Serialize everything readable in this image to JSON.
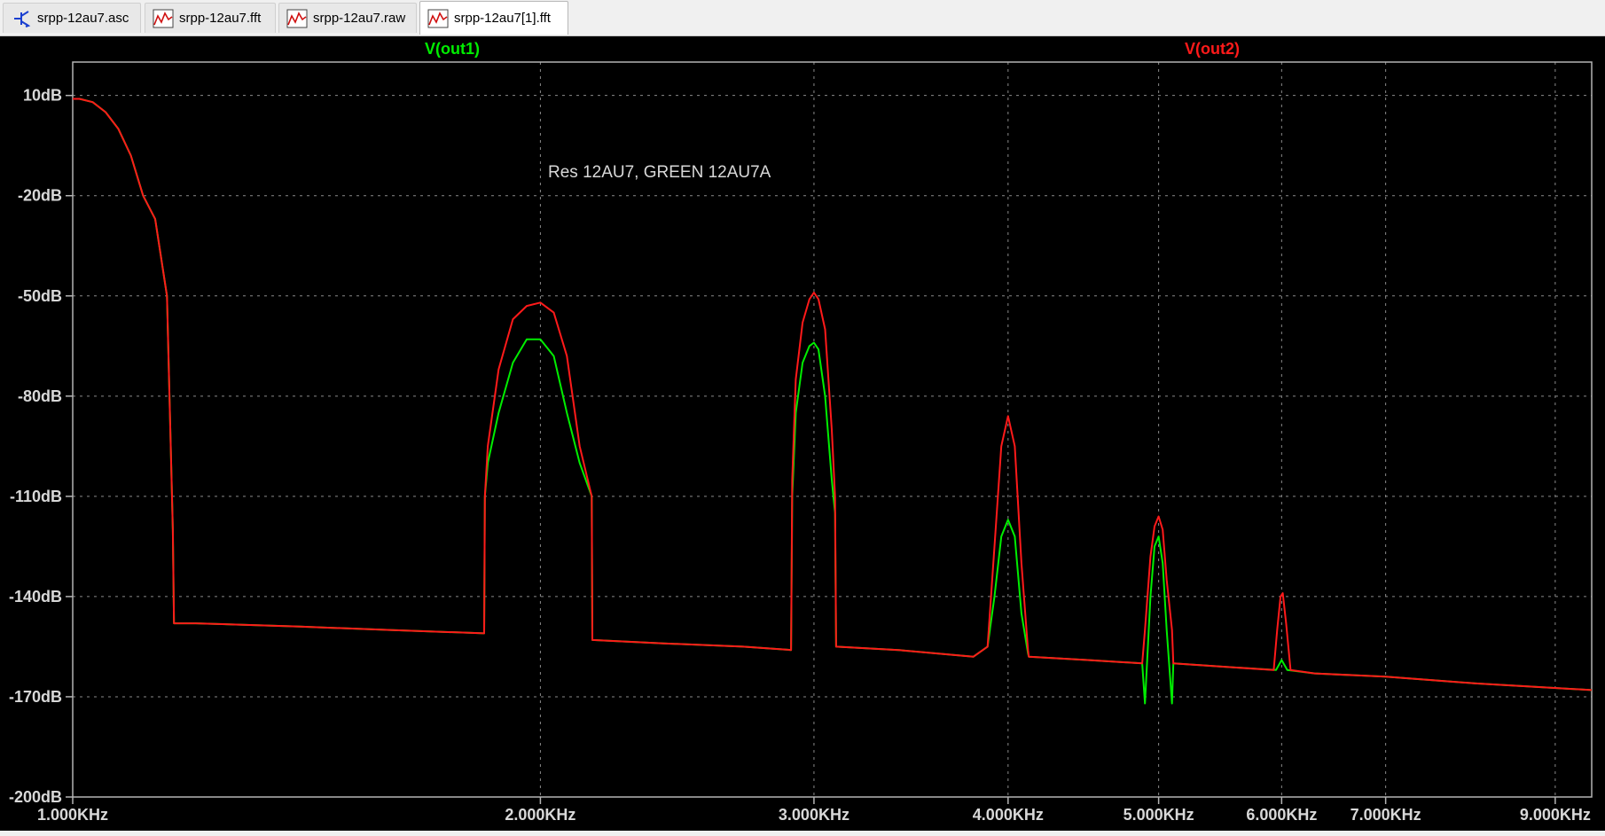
{
  "tabs": [
    {
      "label": "srpp-12au7.asc",
      "icon": "schematic-icon",
      "active": false
    },
    {
      "label": "srpp-12au7.fft",
      "icon": "waveform-icon",
      "active": false
    },
    {
      "label": "srpp-12au7.raw",
      "icon": "waveform-icon",
      "active": false
    },
    {
      "label": "srpp-12au7[1].fft",
      "icon": "waveform-icon",
      "active": true
    }
  ],
  "colors": {
    "background": "#000000",
    "grid": "#8a8a8a",
    "axis": "#b4b4b4",
    "tick_text": "#d8d8d8",
    "out1": "#00ee00",
    "out2": "#ff1a1a"
  },
  "chart_data": {
    "type": "line",
    "x_scale": "log",
    "xlim": [
      1000,
      9500
    ],
    "ylim": [
      -200,
      20
    ],
    "x_ticks": [
      {
        "value": 1000,
        "label": "1.000KHz"
      },
      {
        "value": 2000,
        "label": "2.000KHz"
      },
      {
        "value": 3000,
        "label": "3.000KHz"
      },
      {
        "value": 4000,
        "label": "4.000KHz"
      },
      {
        "value": 5000,
        "label": "5.000KHz"
      },
      {
        "value": 6000,
        "label": "6.000KHz"
      },
      {
        "value": 7000,
        "label": "7.000KHz"
      },
      {
        "value": 9000,
        "label": "9.000KHz"
      }
    ],
    "y_ticks": [
      {
        "value": 10,
        "label": "10dB"
      },
      {
        "value": -20,
        "label": "-20dB"
      },
      {
        "value": -50,
        "label": "-50dB"
      },
      {
        "value": -80,
        "label": "-80dB"
      },
      {
        "value": -110,
        "label": "-110dB"
      },
      {
        "value": -140,
        "label": "-140dB"
      },
      {
        "value": -170,
        "label": "-170dB"
      },
      {
        "value": -200,
        "label": "-200dB"
      }
    ],
    "annotation": "Res 12AU7, GREEN 12AU7A",
    "series": [
      {
        "name": "V(out1)",
        "color": "#00ee00",
        "x": [
          1000,
          1010,
          1030,
          1050,
          1070,
          1090,
          1110,
          1130,
          1150,
          1160,
          1162,
          1200,
          1400,
          1600,
          1840,
          1842,
          1850,
          1880,
          1920,
          1960,
          2000,
          2040,
          2080,
          2120,
          2158,
          2160,
          2400,
          2700,
          2900,
          2905,
          2920,
          2950,
          2980,
          3000,
          3020,
          3050,
          3080,
          3095,
          3100,
          3400,
          3800,
          3880,
          3920,
          3960,
          4000,
          4040,
          4080,
          4120,
          4125,
          4500,
          4880,
          4900,
          4940,
          4970,
          5000,
          5030,
          5060,
          5100,
          5110,
          5500,
          5950,
          6000,
          6050,
          6300,
          7000,
          8000,
          9500
        ],
        "y": [
          9,
          9,
          8,
          5,
          0,
          -8,
          -20,
          -27,
          -50,
          -120,
          -148,
          -148,
          -149,
          -150,
          -151,
          -110,
          -100,
          -85,
          -70,
          -63,
          -63,
          -68,
          -85,
          -100,
          -110,
          -153,
          -154,
          -155,
          -156,
          -110,
          -85,
          -70,
          -65,
          -64,
          -66,
          -80,
          -105,
          -115,
          -155,
          -156,
          -158,
          -155,
          -140,
          -122,
          -117,
          -122,
          -145,
          -157,
          -158,
          -159,
          -160,
          -172,
          -140,
          -125,
          -122,
          -130,
          -150,
          -172,
          -160,
          -161,
          -162,
          -159,
          -162,
          -163,
          -164,
          -166,
          -168
        ]
      },
      {
        "name": "V(out2)",
        "color": "#ff1a1a",
        "x": [
          1000,
          1010,
          1030,
          1050,
          1070,
          1090,
          1110,
          1130,
          1150,
          1160,
          1162,
          1200,
          1400,
          1600,
          1840,
          1842,
          1850,
          1880,
          1920,
          1960,
          2000,
          2040,
          2080,
          2120,
          2158,
          2160,
          2400,
          2700,
          2900,
          2905,
          2920,
          2950,
          2980,
          3000,
          3020,
          3050,
          3080,
          3095,
          3100,
          3400,
          3800,
          3880,
          3920,
          3960,
          4000,
          4040,
          4080,
          4120,
          4125,
          4500,
          4880,
          4900,
          4940,
          4970,
          5000,
          5030,
          5060,
          5100,
          5110,
          5500,
          5930,
          5960,
          5990,
          6010,
          6040,
          6080,
          6300,
          7000,
          8000,
          9500
        ],
        "y": [
          9,
          9,
          8,
          5,
          0,
          -8,
          -20,
          -27,
          -50,
          -120,
          -148,
          -148,
          -149,
          -150,
          -151,
          -110,
          -95,
          -72,
          -57,
          -53,
          -52,
          -55,
          -68,
          -95,
          -110,
          -153,
          -154,
          -155,
          -156,
          -105,
          -75,
          -58,
          -51,
          -49,
          -51,
          -60,
          -90,
          -110,
          -155,
          -156,
          -158,
          -155,
          -125,
          -95,
          -86,
          -95,
          -130,
          -156,
          -158,
          -159,
          -160,
          -150,
          -128,
          -119,
          -116,
          -120,
          -135,
          -150,
          -160,
          -161,
          -162,
          -150,
          -140,
          -139,
          -148,
          -162,
          -163,
          -164,
          -166,
          -168
        ]
      }
    ]
  }
}
